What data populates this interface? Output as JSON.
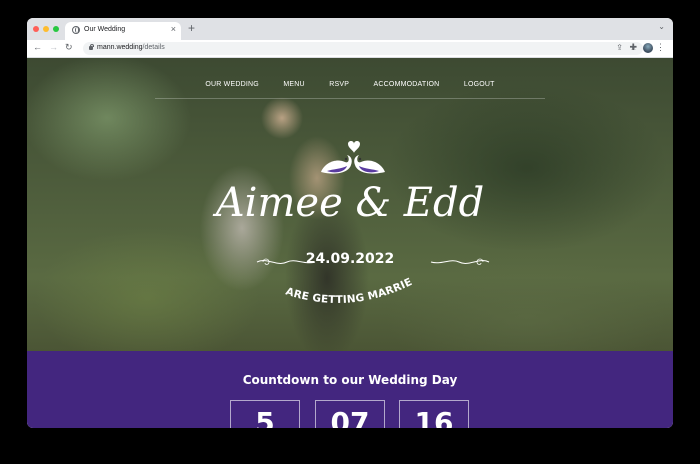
{
  "browser": {
    "tab_title": "Our Wedding",
    "new_tab": "+",
    "close": "×",
    "url_host": "mann.wedding",
    "url_path": "/details"
  },
  "nav": {
    "items": [
      "OUR WEDDING",
      "MENU",
      "RSVP",
      "ACCOMMODATION",
      "LOGOUT"
    ]
  },
  "hero": {
    "names": "Aimee & Edd",
    "date": "24.09.2022",
    "tagline": "ARE GETTING MARRIED"
  },
  "countdown": {
    "title": "Countdown to our Wedding Day",
    "values": [
      "5",
      "07",
      "16"
    ]
  },
  "colors": {
    "accent": "#43267f"
  }
}
